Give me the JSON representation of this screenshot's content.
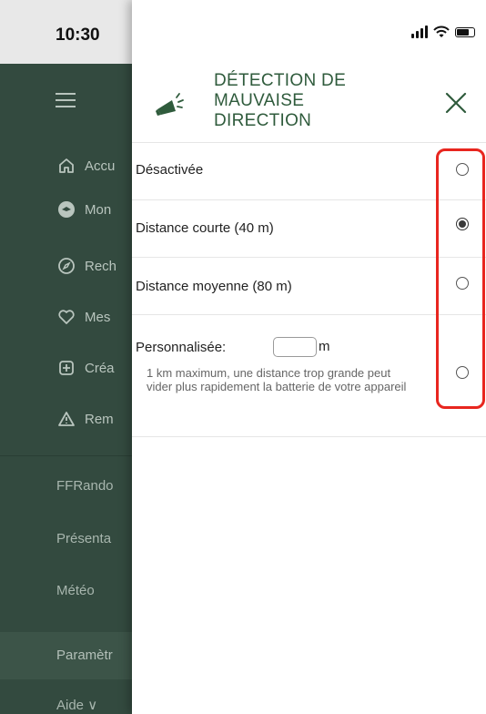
{
  "status_bar": {
    "time": "10:30"
  },
  "sidebar": {
    "items": [
      {
        "label": "Accu",
        "icon": "home-icon"
      },
      {
        "label": "Mon",
        "icon": "hiker-icon"
      },
      {
        "label": "Rech",
        "icon": "compass-icon"
      },
      {
        "label": "Mes",
        "icon": "heart-icon"
      },
      {
        "label": "Créa",
        "icon": "plus-square-icon"
      },
      {
        "label": "Rem",
        "icon": "warning-icon"
      }
    ],
    "links": [
      "FFRando",
      "Présenta",
      "Météo"
    ],
    "settings": "Paramètr",
    "help": "Aide ∨"
  },
  "panel": {
    "title_lines": [
      "DÉTECTION DE",
      "MAUVAISE",
      "DIRECTION"
    ],
    "close_icon": "close-icon",
    "options": [
      {
        "label": "Désactivée",
        "checked": false
      },
      {
        "label": "Distance courte (40 m)",
        "checked": true
      },
      {
        "label": "Distance moyenne (80 m)",
        "checked": false
      }
    ],
    "custom": {
      "label": "Personnalisée:",
      "value": "",
      "unit": "m",
      "hint": "1 km maximum, une distance trop grande peut vider plus rapidement la batterie de votre appareil",
      "checked": false
    }
  },
  "colors": {
    "sidebar_bg": "#334a3f",
    "title_green": "#2f5b3c",
    "highlight_red": "#e8261f"
  }
}
